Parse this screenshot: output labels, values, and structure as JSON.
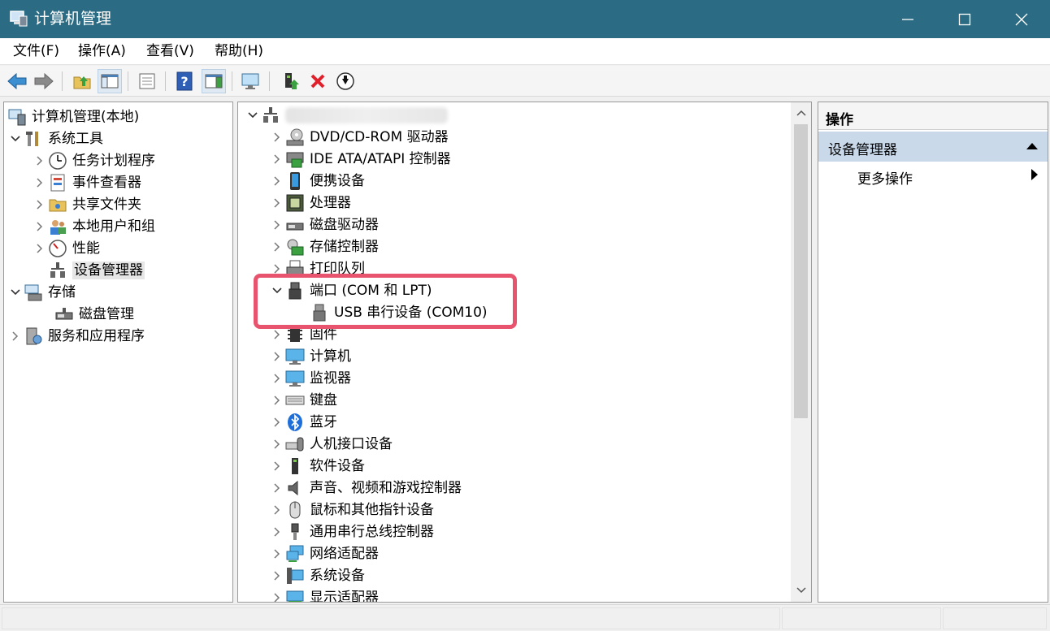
{
  "window": {
    "title": "计算机管理"
  },
  "menu": [
    "文件(F)",
    "操作(A)",
    "查看(V)",
    "帮助(H)"
  ],
  "left_tree": {
    "root": "计算机管理(本地)",
    "system_tools": "系统工具",
    "task_scheduler": "任务计划程序",
    "event_viewer": "事件查看器",
    "shared_folders": "共享文件夹",
    "local_users": "本地用户和组",
    "performance": "性能",
    "device_manager": "设备管理器",
    "storage": "存储",
    "disk_management": "磁盘管理",
    "services_apps": "服务和应用程序"
  },
  "device_tree": {
    "dvd": "DVD/CD-ROM 驱动器",
    "ide": "IDE ATA/ATAPI 控制器",
    "portable": "便携设备",
    "processor": "处理器",
    "disk": "磁盘驱动器",
    "storage_ctrl": "存储控制器",
    "printer_queue": "打印队列",
    "ports": "端口 (COM 和 LPT)",
    "usb_serial": "USB 串行设备 (COM10)",
    "firmware": "固件",
    "computer": "计算机",
    "monitor": "监视器",
    "keyboard": "键盘",
    "bluetooth": "蓝牙",
    "hid": "人机接口设备",
    "software_dev": "软件设备",
    "sound": "声音、视频和游戏控制器",
    "mouse": "鼠标和其他指针设备",
    "usb_ctrl": "通用串行总线控制器",
    "network": "网络适配器",
    "system_dev": "系统设备",
    "display": "显示适配器"
  },
  "actions": {
    "header": "操作",
    "group": "设备管理器",
    "more": "更多操作"
  },
  "colors": {
    "titlebar": "#2b6c84",
    "highlight": "#e8546e",
    "action_group_bg": "#c9d9ea"
  }
}
